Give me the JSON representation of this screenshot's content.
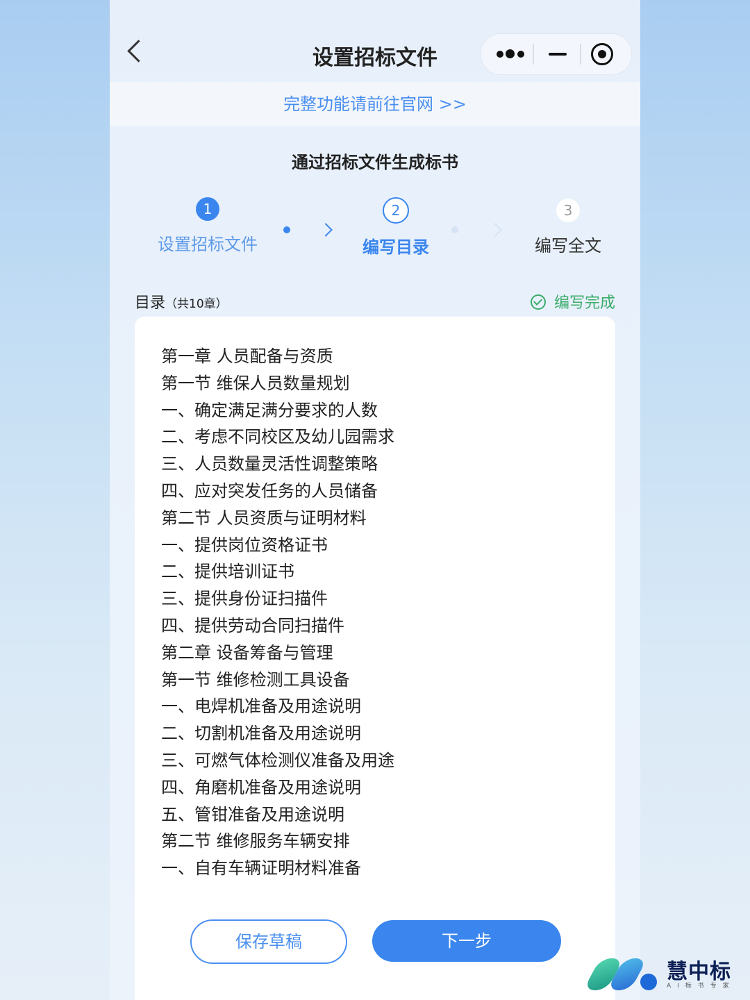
{
  "nav": {
    "title": "设置招标文件"
  },
  "capsule": {
    "more_icon": "more-dots-icon",
    "minimize_icon": "minimize-icon",
    "record_icon": "record-icon"
  },
  "banner": {
    "text": "完整功能请前往官网 >>"
  },
  "subtitle": "通过招标文件生成标书",
  "steps": [
    {
      "number": "1",
      "label": "设置招标文件",
      "state": "done"
    },
    {
      "number": "2",
      "label": "编写目录",
      "state": "active"
    },
    {
      "number": "3",
      "label": "编写全文",
      "state": "pending"
    }
  ],
  "toc": {
    "title": "目录",
    "count": "（共10章）",
    "status": "编写完成",
    "items": [
      "第一章 人员配备与资质",
      "第一节 维保人员数量规划",
      "一、确定满足满分要求的人数",
      "二、考虑不同校区及幼儿园需求",
      "三、人员数量灵活性调整策略",
      "四、应对突发任务的人员储备",
      "第二节 人员资质与证明材料",
      "一、提供岗位资格证书",
      "二、提供培训证书",
      "三、提供身份证扫描件",
      "四、提供劳动合同扫描件",
      "第二章 设备筹备与管理",
      "第一节 维修检测工具设备",
      "一、电焊机准备及用途说明",
      "二、切割机准备及用途说明",
      "三、可燃气体检测仪准备及用途",
      "四、角磨机准备及用途说明",
      "五、管钳准备及用途说明",
      "第二节 维修服务车辆安排",
      "一、自有车辆证明材料准备"
    ]
  },
  "buttons": {
    "save": "保存草稿",
    "next": "下一步"
  },
  "logo": {
    "name": "慧中标",
    "tagline": "AI标书专家"
  },
  "colors": {
    "accent": "#3a86ee",
    "success": "#3aac6a",
    "text": "#222222"
  }
}
